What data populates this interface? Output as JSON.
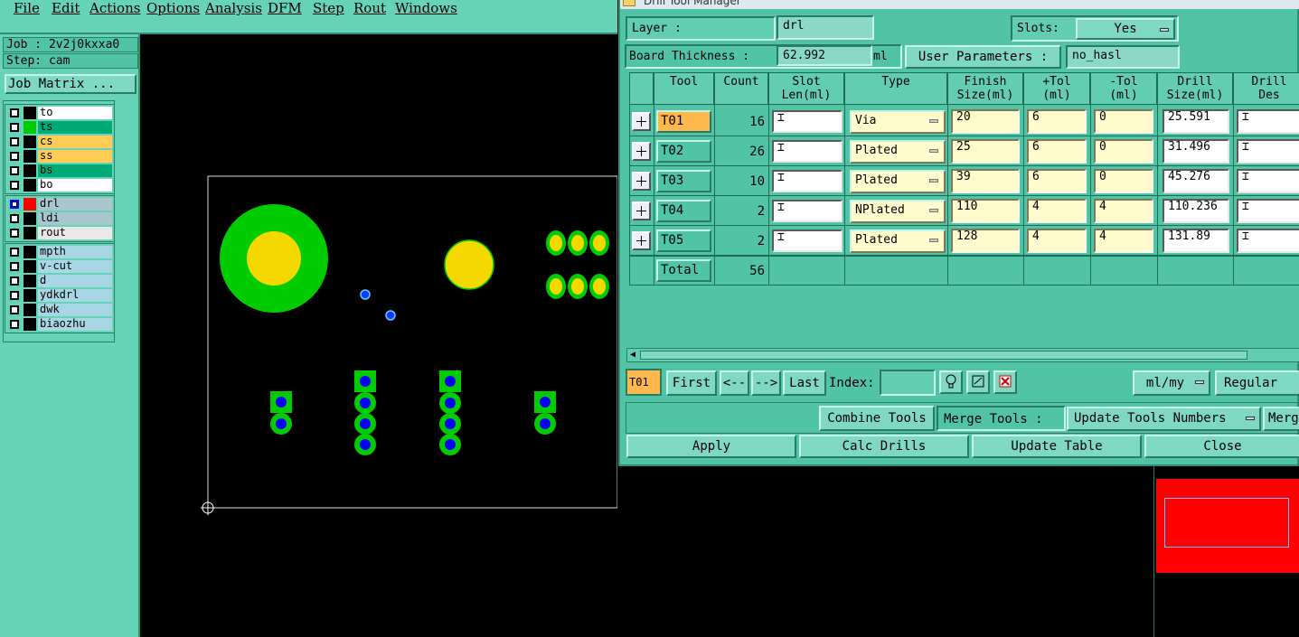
{
  "menubar": {
    "items": [
      "File",
      "Edit",
      "Actions",
      "Options",
      "Analysis",
      "DFM",
      "Step",
      "Rout",
      "Windows"
    ]
  },
  "job": {
    "job_label": "Job : 2v2j0kxxa0",
    "step_label": "Step: cam",
    "matrix_button": "Job Matrix ..."
  },
  "layers": {
    "group1": [
      {
        "name": "to",
        "color": "#ffffff",
        "swatch": "#000000",
        "checked": false
      },
      {
        "name": "ts",
        "color": "#00aa77",
        "swatch": "#00cc00",
        "checked": false
      },
      {
        "name": "cs",
        "color": "#ffcc55",
        "swatch": "#000000",
        "checked": false
      },
      {
        "name": "ss",
        "color": "#ffcc55",
        "swatch": "#000000",
        "checked": false
      },
      {
        "name": "bs",
        "color": "#00aa77",
        "swatch": "#000000",
        "checked": false
      },
      {
        "name": "bo",
        "color": "#ffffff",
        "swatch": "#000000",
        "checked": false
      }
    ],
    "group2": [
      {
        "name": "drl",
        "color": "#a9c6cf",
        "swatch": "#ff0000",
        "checked": true
      },
      {
        "name": "ldi",
        "color": "#a9c6cf",
        "swatch": "#000000",
        "checked": false
      },
      {
        "name": "rout",
        "color": "#e8e8e8",
        "swatch": "#000000",
        "checked": false
      }
    ],
    "group3": [
      {
        "name": "mpth",
        "color": "#a9d6e5",
        "swatch": "#000000",
        "checked": false
      },
      {
        "name": "v-cut",
        "color": "#a9d6e5",
        "swatch": "#000000",
        "checked": false
      },
      {
        "name": "d",
        "color": "#a9d6e5",
        "swatch": "#000000",
        "checked": false
      },
      {
        "name": "ydkdrl",
        "color": "#a9d6e5",
        "swatch": "#000000",
        "checked": false
      },
      {
        "name": "dwk",
        "color": "#a9d6e5",
        "swatch": "#000000",
        "checked": false
      },
      {
        "name": "biaozhu",
        "color": "#a9d6e5",
        "swatch": "#000000",
        "checked": false
      }
    ]
  },
  "dialog": {
    "title": "Drill Tool Manager",
    "layer_label": "Layer        :",
    "layer_value": "drl",
    "slots_label": "Slots:",
    "slots_value": "Yes",
    "board_thickness_label": "Board Thickness :",
    "board_thickness_value": "62.992",
    "board_thickness_unit": "ml",
    "user_params_label": "User Parameters :",
    "user_params_value": "no_hasl",
    "columns": [
      "Tool",
      "Count",
      "Slot\nLen(ml)",
      "Type",
      "Finish\nSize(ml)",
      "+Tol\n(ml)",
      "-Tol\n(ml)",
      "Drill\nSize(ml)",
      "Drill\nDes"
    ],
    "rows": [
      {
        "tool": "T01",
        "count": "16",
        "slot_len": "",
        "type": "Via",
        "finish": "20",
        "ptol": "6",
        "ntol": "0",
        "drill": "25.591",
        "des": ""
      },
      {
        "tool": "T02",
        "count": "26",
        "slot_len": "",
        "type": "Plated",
        "finish": "25",
        "ptol": "6",
        "ntol": "0",
        "drill": "31.496",
        "des": ""
      },
      {
        "tool": "T03",
        "count": "10",
        "slot_len": "",
        "type": "Plated",
        "finish": "39",
        "ptol": "6",
        "ntol": "0",
        "drill": "45.276",
        "des": ""
      },
      {
        "tool": "T04",
        "count": "2",
        "slot_len": "",
        "type": "NPlated",
        "finish": "110",
        "ptol": "4",
        "ntol": "4",
        "drill": "110.236",
        "des": ""
      },
      {
        "tool": "T05",
        "count": "2",
        "slot_len": "",
        "type": "Plated",
        "finish": "128",
        "ptol": "4",
        "ntol": "4",
        "drill": "131.89",
        "des": ""
      }
    ],
    "total_label": "Total",
    "total_count": "56",
    "nav": {
      "current": "T01",
      "first": "First",
      "prev": "<--",
      "next": "-->",
      "last": "Last",
      "index_label": "Index:",
      "units": "ml/my",
      "mode": "Regular"
    },
    "combine_tools": "Combine Tools",
    "merge_tools_label": "Merge Tools :",
    "merge_tools_value": "Update Tools Numbers",
    "merge_cut": "Merg",
    "buttons": {
      "apply": "Apply",
      "calc": "Calc Drills",
      "update": "Update Table",
      "close": "Close"
    }
  },
  "colors": {
    "panel": "#66d2b6",
    "highlight": "#ffb84d",
    "pad_green": "#00cc00",
    "pad_yellow": "#f5d800",
    "drill_blue": "#0000ff",
    "red_preview": "#ff0000"
  }
}
